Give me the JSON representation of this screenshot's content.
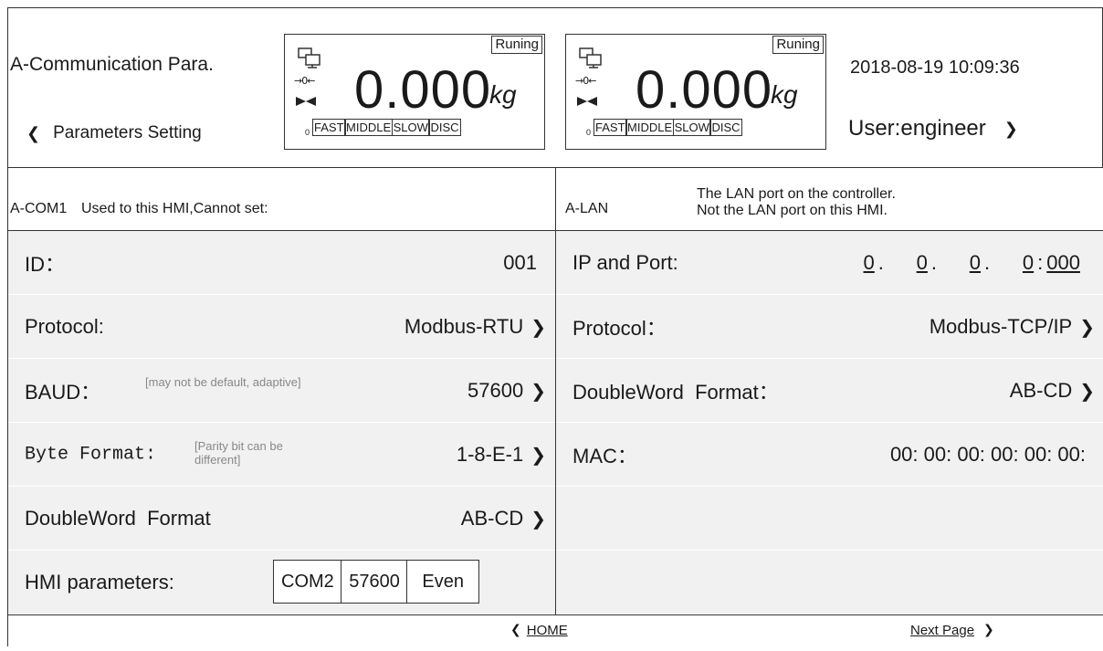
{
  "header": {
    "title": "A-Communication Para.",
    "back_label": "Parameters Setting",
    "datetime": "2018-08-19 10:09:36",
    "user": "User:engineer",
    "panels": [
      {
        "status": "Runing",
        "weight": "0.000",
        "unit": "kg",
        "zero_mark": "→0←",
        "zero_small": "0",
        "modes": [
          "FAST",
          "MIDDLE",
          "SLOW",
          "DISC"
        ]
      },
      {
        "status": "Runing",
        "weight": "0.000",
        "unit": "kg",
        "zero_mark": "→0←",
        "zero_small": "0",
        "modes": [
          "FAST",
          "MIDDLE",
          "SLOW",
          "DISC"
        ]
      }
    ]
  },
  "left": {
    "head_name": "A-COM1",
    "head_note": "Used to this HMI,Cannot set:",
    "rows": [
      {
        "label": "ID：",
        "value": "001"
      },
      {
        "label": "Protocol:",
        "value": "Modbus-RTU"
      },
      {
        "label": "BAUD：",
        "note": "[may  not be default, adaptive]",
        "value": "57600"
      },
      {
        "label": "Byte Format:",
        "note": "[Parity bit can be different]",
        "value": "1-8-E-1"
      },
      {
        "label": "DoubleWord  Format",
        "value": "AB-CD"
      },
      {
        "label": "HMI parameters:",
        "boxes": [
          "COM2",
          "57600",
          "Even"
        ]
      }
    ]
  },
  "right": {
    "head_name": "A-LAN",
    "head_note_line1": "The LAN port on the controller.",
    "head_note_line2": "Not the LAN port on this HMI.",
    "rows": [
      {
        "label": "IP and Port:",
        "ip": [
          "0",
          "0",
          "0",
          "0"
        ],
        "port": "000"
      },
      {
        "label": "Protocol：",
        "value": "Modbus-TCP/IP"
      },
      {
        "label": "DoubleWord  Format：",
        "value": "AB-CD"
      },
      {
        "label": "MAC：",
        "mac": "00: 00: 00: 00: 00: 00:"
      }
    ]
  },
  "footer": {
    "home": "HOME",
    "next": "Next Page"
  }
}
